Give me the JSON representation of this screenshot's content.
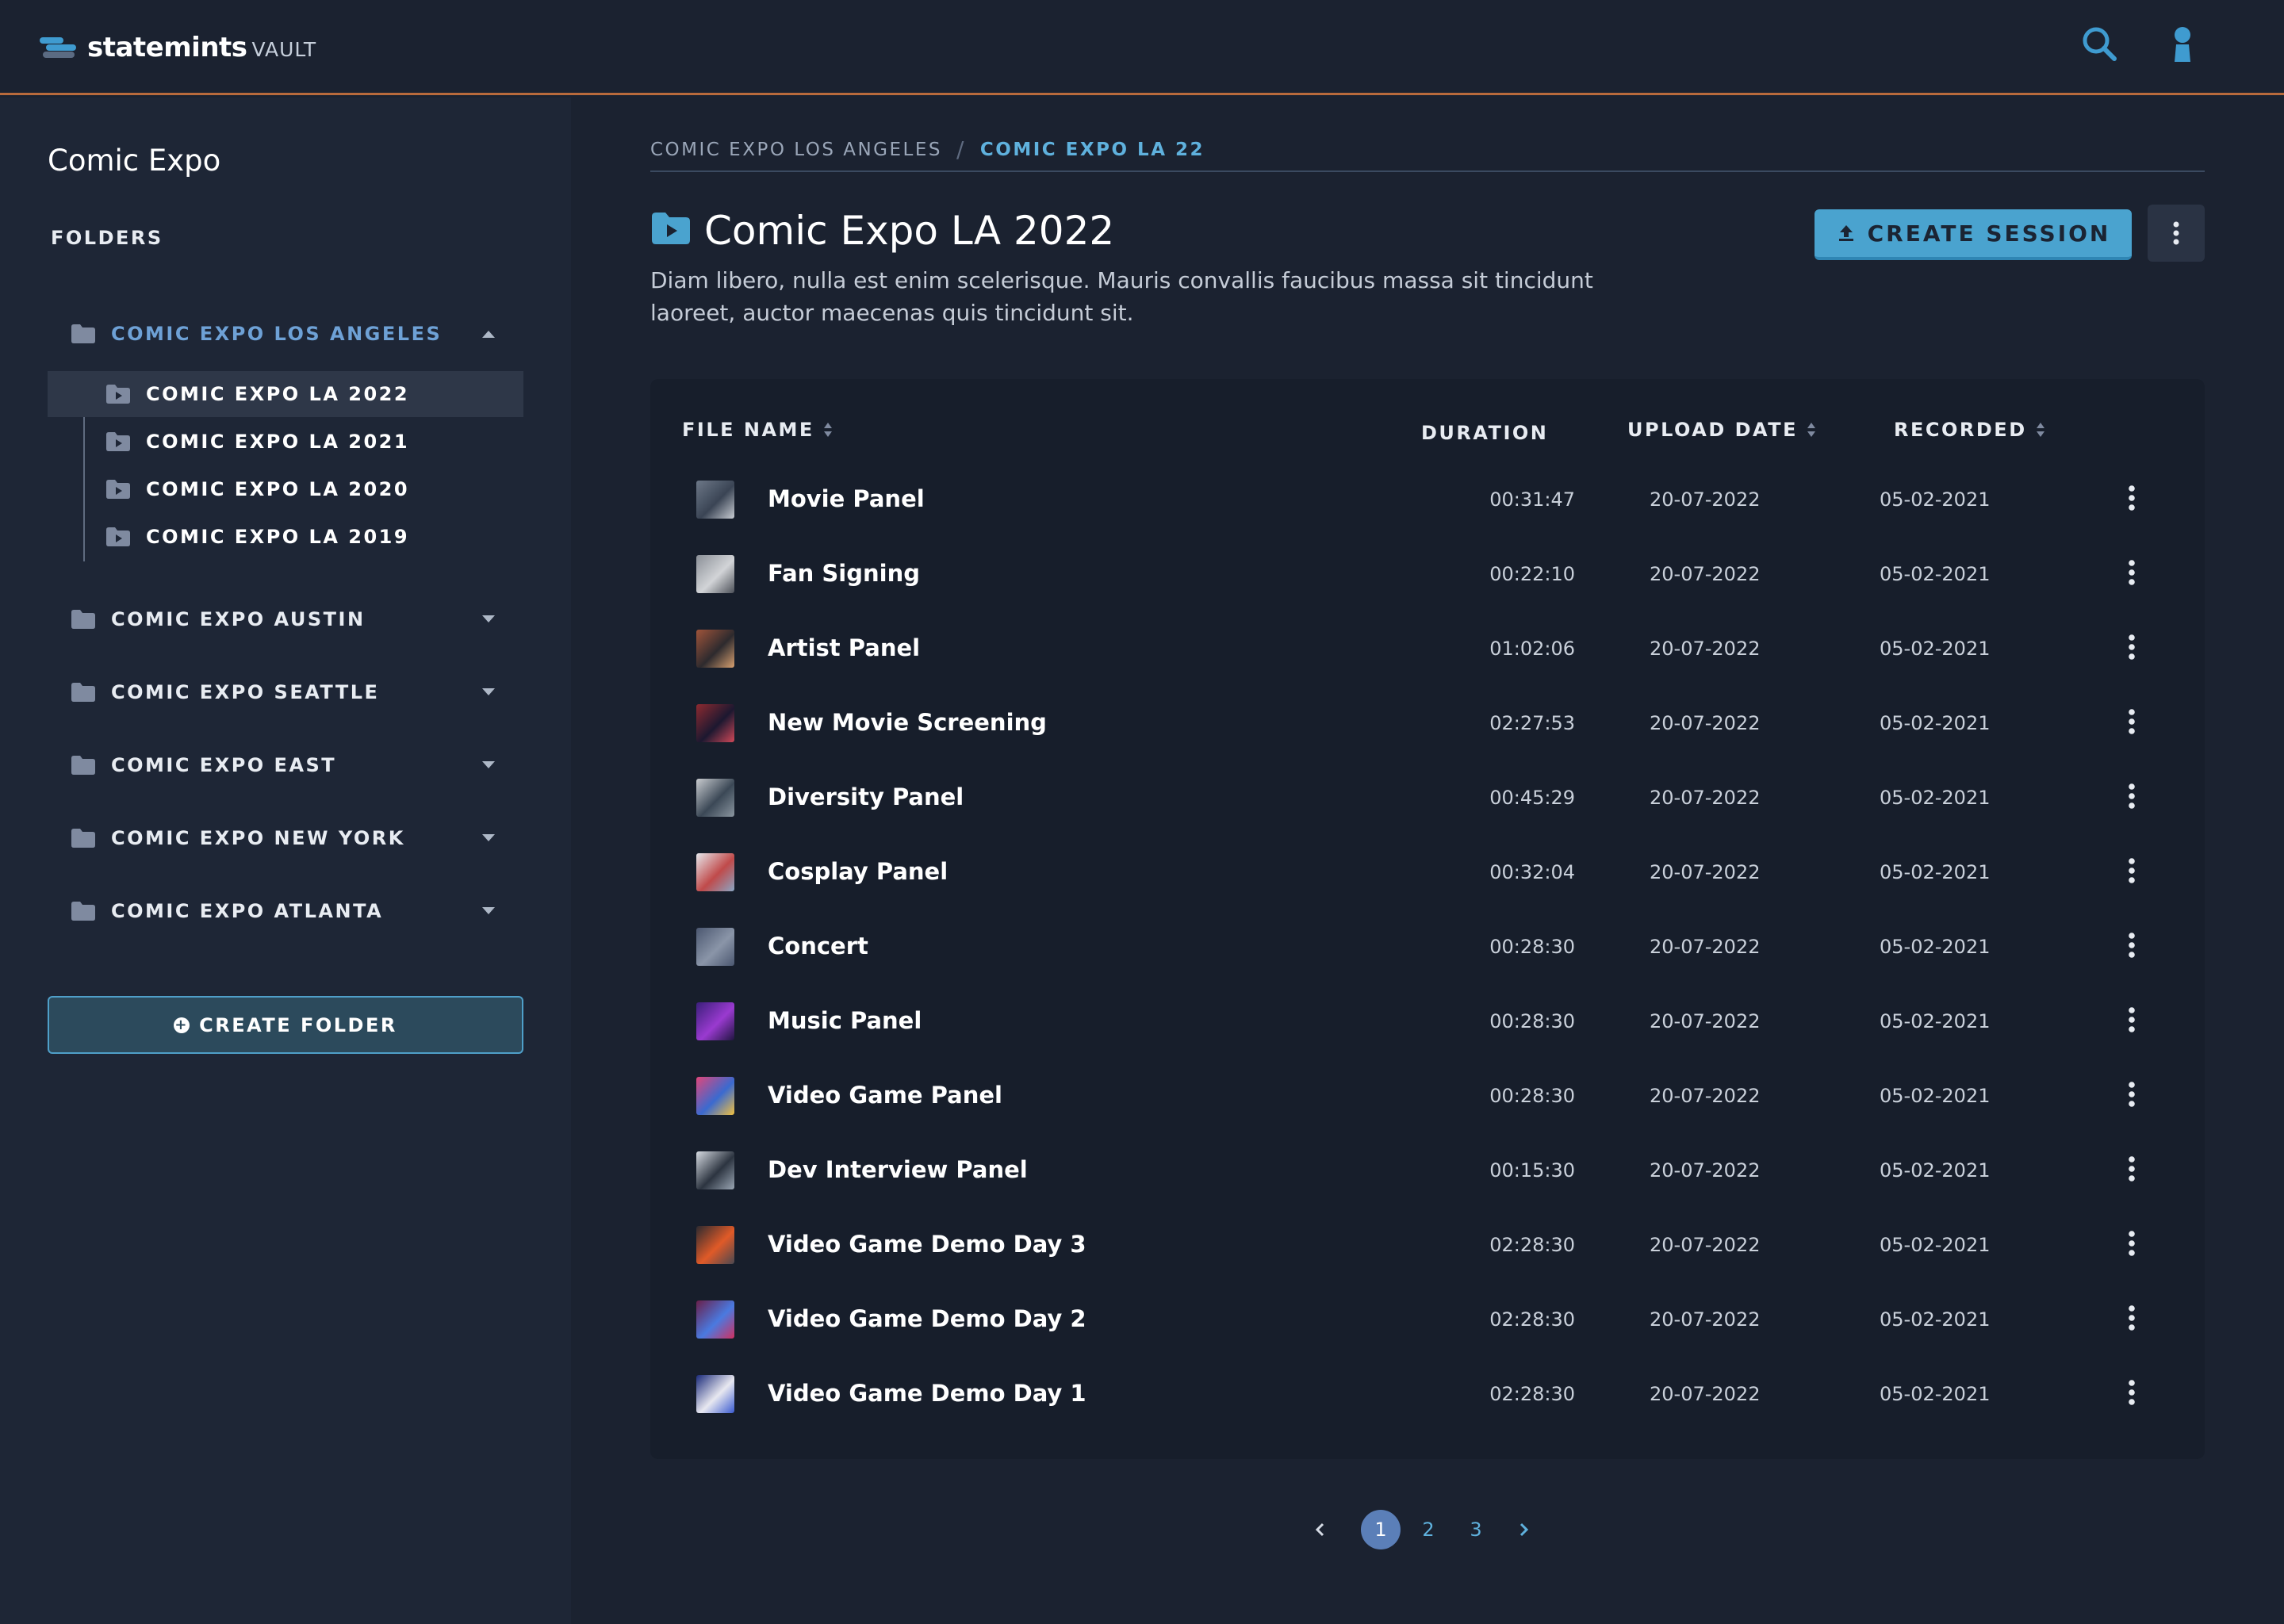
{
  "brand": {
    "name": "statemints",
    "sub": "VAULT"
  },
  "header": {
    "search_icon": "search-icon",
    "user_icon": "user-icon"
  },
  "sidebar": {
    "title": "Comic Expo",
    "folders_label": "FOLDERS",
    "open_folder": {
      "label": "COMIC EXPO LOS ANGELES",
      "children": [
        "COMIC EXPO LA 2022",
        "COMIC EXPO LA 2021",
        "COMIC EXPO LA 2020",
        "COMIC EXPO LA 2019"
      ],
      "active_child": "COMIC EXPO LA 2022"
    },
    "folders": [
      "COMIC EXPO AUSTIN",
      "COMIC EXPO SEATTLE",
      "COMIC EXPO EAST",
      "COMIC EXPO NEW YORK",
      "COMIC EXPO ATLANTA"
    ],
    "create_folder_label": "CREATE FOLDER"
  },
  "breadcrumb": {
    "parent": "COMIC EXPO LOS ANGELES",
    "separator": "/",
    "current": "COMIC EXPO LA 22"
  },
  "main": {
    "title": "Comic Expo LA 2022",
    "description": "Diam libero, nulla est enim scelerisque. Mauris convallis faucibus massa sit tincidunt laoreet, auctor maecenas quis tincidunt sit.",
    "create_session_label": "CREATE SESSION"
  },
  "table": {
    "headers": {
      "file_name": "FILE NAME",
      "duration": "DURATION",
      "upload_date": "UPLOAD DATE",
      "recorded": "RECORDED"
    },
    "rows": [
      {
        "name": "Movie Panel",
        "duration": "00:31:47",
        "upload": "20-07-2022",
        "recorded": "05-02-2021",
        "thumb": [
          "#6d7888",
          "#3a4454",
          "#c8ccd2"
        ]
      },
      {
        "name": "Fan Signing",
        "duration": "00:22:10",
        "upload": "20-07-2022",
        "recorded": "05-02-2021",
        "thumb": [
          "#8a8f97",
          "#d2d4d7",
          "#4c5058"
        ]
      },
      {
        "name": "Artist Panel",
        "duration": "01:02:06",
        "upload": "20-07-2022",
        "recorded": "05-02-2021",
        "thumb": [
          "#a0543a",
          "#2d2a2e",
          "#d8a070"
        ]
      },
      {
        "name": "New Movie Screening",
        "duration": "02:27:53",
        "upload": "20-07-2022",
        "recorded": "05-02-2021",
        "thumb": [
          "#8e2a30",
          "#1c1830",
          "#d04858"
        ]
      },
      {
        "name": "Diversity Panel",
        "duration": "00:45:29",
        "upload": "20-07-2022",
        "recorded": "05-02-2021",
        "thumb": [
          "#c9ccd0",
          "#3b4856",
          "#8b96a0"
        ]
      },
      {
        "name": "Cosplay Panel",
        "duration": "00:32:04",
        "upload": "20-07-2022",
        "recorded": "05-02-2021",
        "thumb": [
          "#e6e8ec",
          "#c04a4a",
          "#8aa6c4"
        ]
      },
      {
        "name": "Concert",
        "duration": "00:28:30",
        "upload": "20-07-2022",
        "recorded": "05-02-2021",
        "thumb": [
          "#4b5770",
          "#8a95a8",
          "#4b5770"
        ]
      },
      {
        "name": "Music Panel",
        "duration": "00:28:30",
        "upload": "20-07-2022",
        "recorded": "05-02-2021",
        "thumb": [
          "#3a1f7a",
          "#9a3ad0",
          "#201540"
        ]
      },
      {
        "name": "Video Game Panel",
        "duration": "00:28:30",
        "upload": "20-07-2022",
        "recorded": "05-02-2021",
        "thumb": [
          "#e0467a",
          "#3a6ad0",
          "#f0c040"
        ]
      },
      {
        "name": "Dev Interview Panel",
        "duration": "00:15:30",
        "upload": "20-07-2022",
        "recorded": "05-02-2021",
        "thumb": [
          "#d6dbe2",
          "#2c3440",
          "#9aa6b4"
        ]
      },
      {
        "name": "Video Game Demo Day 3",
        "duration": "02:28:30",
        "upload": "20-07-2022",
        "recorded": "05-02-2021",
        "thumb": [
          "#2b2a30",
          "#e05a28",
          "#4a4850"
        ]
      },
      {
        "name": "Video Game Demo Day 2",
        "duration": "02:28:30",
        "upload": "20-07-2022",
        "recorded": "05-02-2021",
        "thumb": [
          "#6a1f4a",
          "#4a7ae0",
          "#d03060"
        ]
      },
      {
        "name": "Video Game Demo Day 1",
        "duration": "02:28:30",
        "upload": "20-07-2022",
        "recorded": "05-02-2021",
        "thumb": [
          "#1a2a7a",
          "#e8e8f0",
          "#3a5ad0"
        ]
      }
    ]
  },
  "pagination": {
    "pages": [
      "1",
      "2",
      "3"
    ],
    "current": "1"
  },
  "colors": {
    "accent": "#4aa3cf",
    "active_folder": "#6ea1d6",
    "header_rule": "#b86a3c",
    "page_active": "#5b7fb8"
  }
}
